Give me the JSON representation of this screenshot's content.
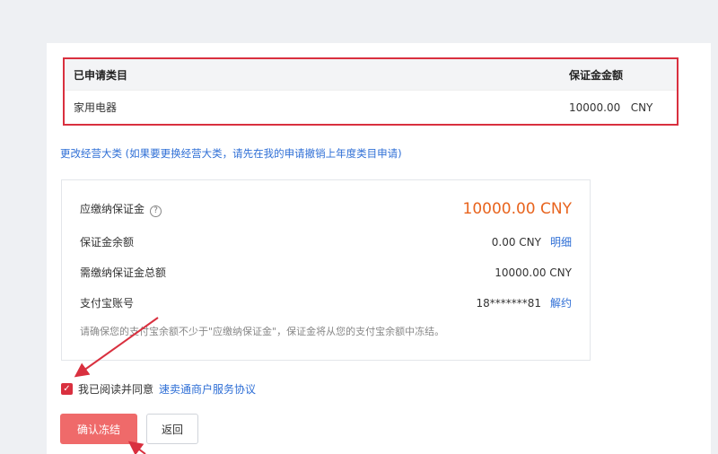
{
  "categories": {
    "header": {
      "category": "已申请类目",
      "amount": "保证金金额"
    },
    "rows": [
      {
        "category": "家用电器",
        "amount": "10000.00   CNY"
      }
    ]
  },
  "change_link": "更改经营大类 (如果要更换经营大类，请先在我的申请撤销上年度类目申请)",
  "deposit": {
    "payable_label": "应缴纳保证金",
    "payable_value": "10000.00 CNY",
    "balance_label": "保证金余额",
    "balance_value": "0.00 CNY",
    "balance_link": "明细",
    "total_label": "需缴纳保证金总额",
    "total_value": "10000.00 CNY",
    "alipay_label": "支付宝账号",
    "alipay_value": "18*******81",
    "alipay_link": "解约",
    "tip": "请确保您的支付宝余额不少于\"应缴纳保证金\"，保证金将从您的支付宝余额中冻结。"
  },
  "agreement": {
    "checked": true,
    "text": "我已阅读并同意",
    "link": "速卖通商户服务协议"
  },
  "buttons": {
    "confirm": "确认冻结",
    "back": "返回"
  },
  "colors": {
    "accent_red": "#d9303f",
    "link_blue": "#2f6fd6",
    "amount_orange": "#e8641e",
    "confirm_bg": "#ef6a6a"
  }
}
